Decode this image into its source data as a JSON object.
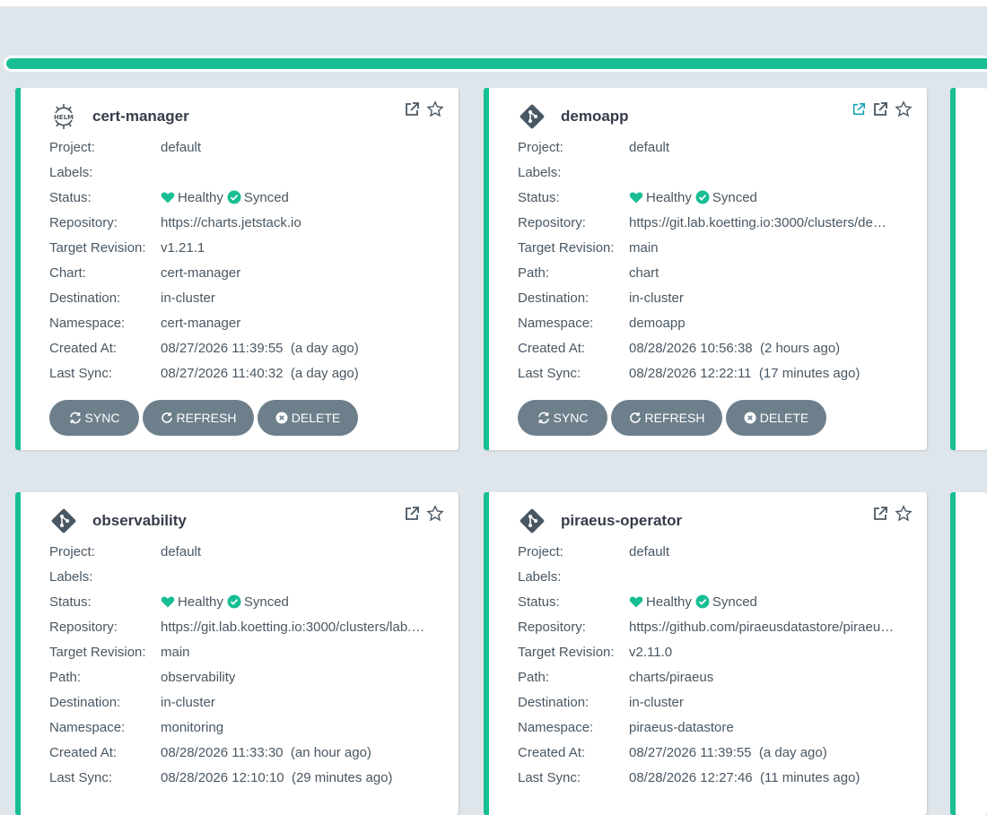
{
  "colors": {
    "accent": "#18be94",
    "button": "#6d7f8b",
    "background": "#dee6eb"
  },
  "labels": {
    "project": "Project:",
    "labels": "Labels:",
    "status": "Status:",
    "repository": "Repository:",
    "target_revision": "Target Revision:",
    "chart": "Chart:",
    "path": "Path:",
    "destination": "Destination:",
    "namespace": "Namespace:",
    "created_at": "Created At:",
    "last_sync": "Last Sync:"
  },
  "buttons": {
    "sync": "SYNC",
    "refresh": "REFRESH",
    "delete": "DELETE"
  },
  "apps": [
    {
      "name": "cert-manager",
      "icon": "helm-icon",
      "project": "default",
      "labels": "",
      "health": "Healthy",
      "sync": "Synced",
      "repository": "https://charts.jetstack.io",
      "target_revision": "v1.21.1",
      "source_label": "Chart:",
      "source": "cert-manager",
      "destination": "in-cluster",
      "namespace": "cert-manager",
      "created_at": "08/27/2026 11:39:55  (a day ago)",
      "last_sync": "08/27/2026 11:40:32  (a day ago)"
    },
    {
      "name": "demoapp",
      "icon": "git-icon",
      "project": "default",
      "labels": "",
      "health": "Healthy",
      "sync": "Synced",
      "repository": "https://git.lab.koetting.io:3000/clusters/de…",
      "target_revision": "main",
      "source_label": "Path:",
      "source": "chart",
      "destination": "in-cluster",
      "namespace": "demoapp",
      "created_at": "08/28/2026 10:56:38  (2 hours ago)",
      "last_sync": "08/28/2026 12:22:11  (17 minutes ago)"
    },
    {
      "name": "observability",
      "icon": "git-icon",
      "project": "default",
      "labels": "",
      "health": "Healthy",
      "sync": "Synced",
      "repository": "https://git.lab.koetting.io:3000/clusters/lab.…",
      "target_revision": "main",
      "source_label": "Path:",
      "source": "observability",
      "destination": "in-cluster",
      "namespace": "monitoring",
      "created_at": "08/28/2026 11:33:30  (an hour ago)",
      "last_sync": "08/28/2026 12:10:10  (29 minutes ago)"
    },
    {
      "name": "piraeus-operator",
      "icon": "git-icon",
      "project": "default",
      "labels": "",
      "health": "Healthy",
      "sync": "Synced",
      "repository": "https://github.com/piraeusdatastore/piraeu…",
      "target_revision": "v2.11.0",
      "source_label": "Path:",
      "source": "charts/piraeus",
      "destination": "in-cluster",
      "namespace": "piraeus-datastore",
      "created_at": "08/27/2026 11:39:55  (a day ago)",
      "last_sync": "08/28/2026 12:27:46  (11 minutes ago)"
    }
  ]
}
